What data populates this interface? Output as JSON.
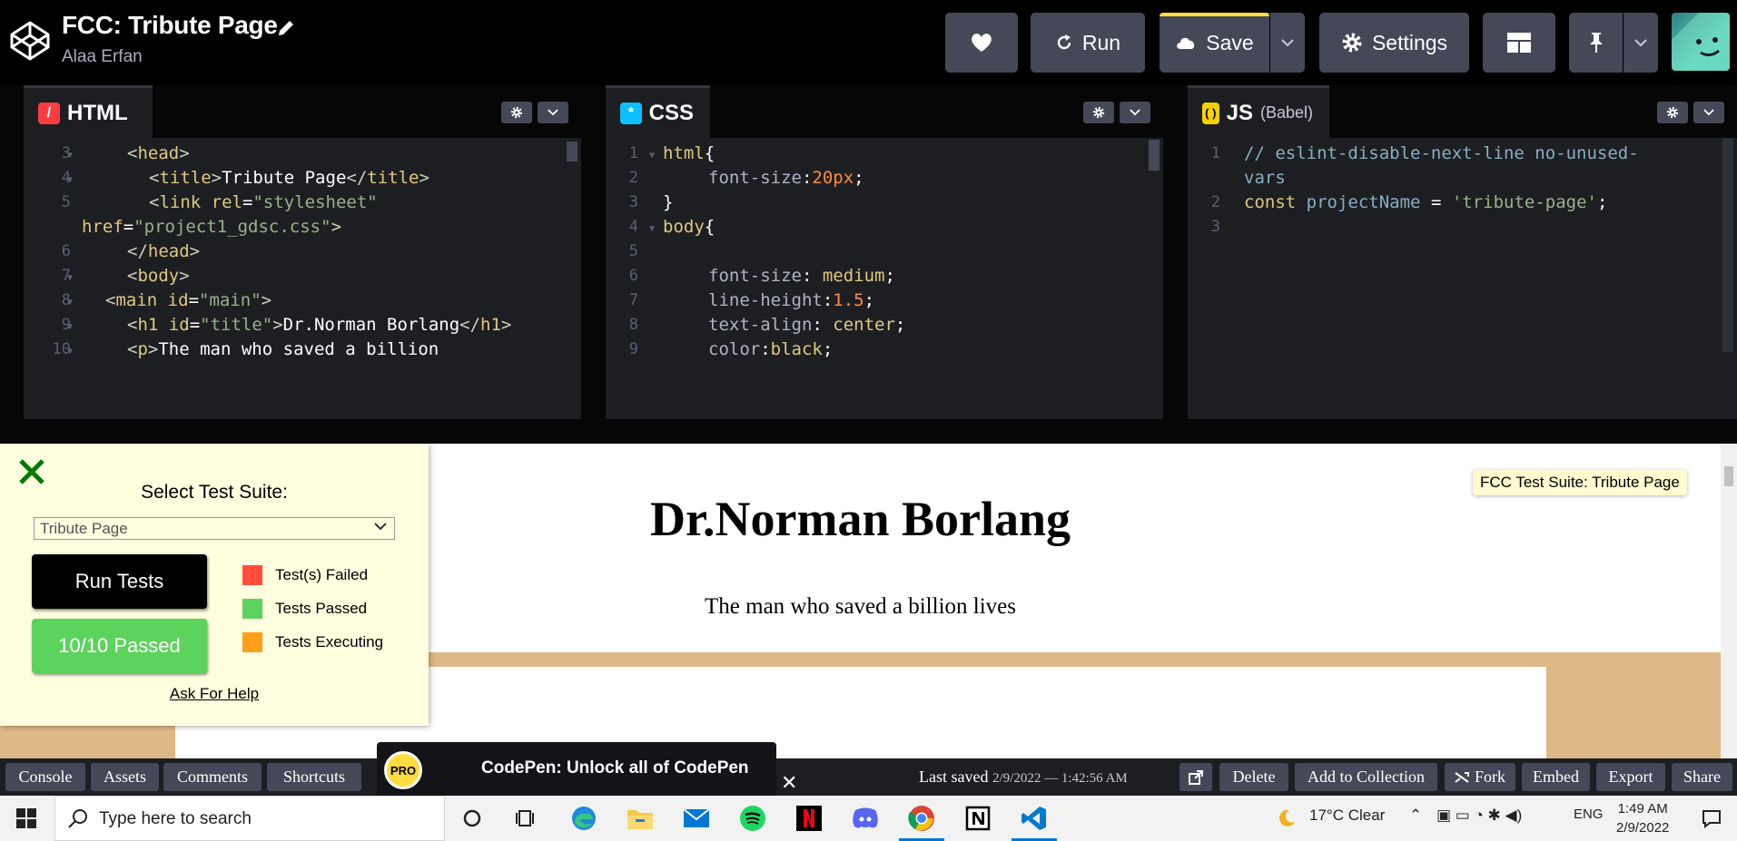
{
  "header": {
    "title": "FCC: Tribute Page",
    "author": "Alaa Erfan",
    "buttons": {
      "run": "Run",
      "save": "Save",
      "settings": "Settings"
    }
  },
  "editors": {
    "html": {
      "label": "HTML",
      "lines": [
        {
          "num": "3",
          "text": "<head>"
        },
        {
          "num": "4",
          "text": "<title>Tribute Page</title>"
        },
        {
          "num": "5",
          "text": "<link rel=\"stylesheet\""
        },
        {
          "num": "",
          "text": "href=\"project1_gdsc.css\">"
        },
        {
          "num": "6",
          "text": "</head>"
        },
        {
          "num": "7",
          "text": "<body>"
        },
        {
          "num": "8",
          "text": "<main id=\"main\">"
        },
        {
          "num": "9",
          "text": "<h1 id=\"title\">Dr.Norman Borlang</h1>"
        },
        {
          "num": "10",
          "text": "<p>The man who saved a billion"
        }
      ]
    },
    "css": {
      "label": "CSS",
      "lines": [
        {
          "num": "1",
          "text": "html{"
        },
        {
          "num": "2",
          "text": "font-size:20px;"
        },
        {
          "num": "3",
          "text": "}"
        },
        {
          "num": "4",
          "text": "body{"
        },
        {
          "num": "5",
          "text": ""
        },
        {
          "num": "6",
          "text": "font-size: medium;"
        },
        {
          "num": "7",
          "text": "line-height:1.5;"
        },
        {
          "num": "8",
          "text": "text-align: center;"
        },
        {
          "num": "9",
          "text": "color:black;"
        }
      ]
    },
    "js": {
      "label": "JS",
      "sublabel": "(Babel)",
      "lines": [
        {
          "num": "1",
          "text": "// eslint-disable-next-line no-unused-"
        },
        {
          "num": "",
          "text": "vars"
        },
        {
          "num": "2",
          "text": "const projectName = 'tribute-page';"
        },
        {
          "num": "3",
          "text": ""
        }
      ]
    }
  },
  "preview": {
    "heading": "Dr.Norman Borlang",
    "subheading": "The man who saved a billion lives",
    "badge": "FCC Test Suite: Tribute Page"
  },
  "test_suite": {
    "title": "Select Test Suite:",
    "selected": "Tribute Page",
    "run_button": "Run Tests",
    "result_button": "10/10 Passed",
    "legend": [
      {
        "label": "Test(s) Failed",
        "color": "#ff4f3a"
      },
      {
        "label": "Tests Passed",
        "color": "#5cd35c"
      },
      {
        "label": "Tests Executing",
        "color": "#ff9f1a"
      }
    ],
    "help_link": "Ask For Help"
  },
  "bottom_bar": {
    "left_buttons": [
      "Console",
      "Assets",
      "Comments",
      "Shortcuts"
    ],
    "promo": {
      "badge": "PRO",
      "text": "CodePen: Unlock all of CodePen"
    },
    "last_saved_label": "Last saved",
    "last_saved_time": "2/9/2022 — 1:42:56 AM",
    "right_buttons": [
      "Delete",
      "Add to Collection",
      "Fork",
      "Embed",
      "Export",
      "Share"
    ]
  },
  "taskbar": {
    "search_placeholder": "Type here to search",
    "weather": "17°C  Clear",
    "language": "ENG",
    "time": "1:49 AM",
    "date": "2/9/2022"
  }
}
